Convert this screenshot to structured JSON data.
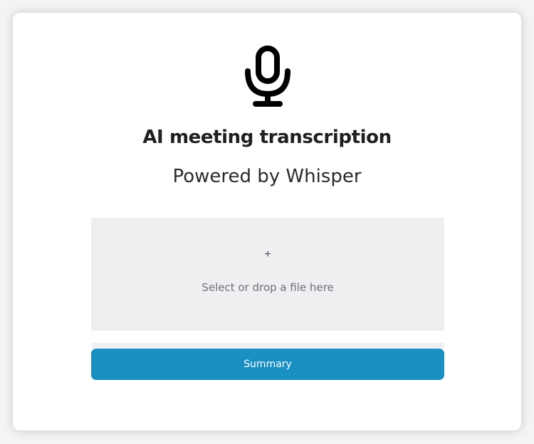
{
  "header": {
    "icon": "microphone-icon",
    "title": "AI meeting transcription",
    "subtitle": "Powered by Whisper"
  },
  "upload": {
    "plus_symbol": "+",
    "prompt": "Select or drop a file here"
  },
  "actions": {
    "summary_label": "Summary"
  },
  "colors": {
    "accent": "#1a8fc1",
    "dropzone_bg": "#eeeff1",
    "card_bg": "#ffffff",
    "text_dark": "#1f1f22"
  }
}
